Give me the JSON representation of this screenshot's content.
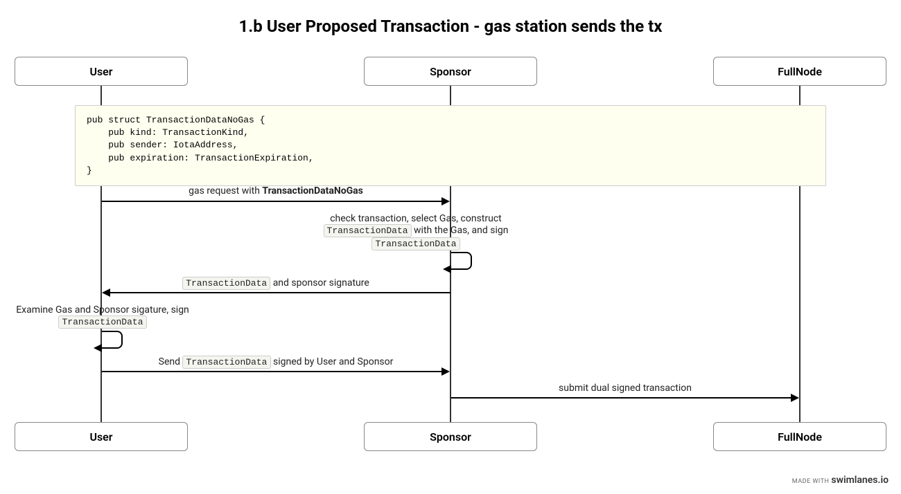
{
  "title": "1.b User Proposed Transaction - gas station sends the tx",
  "lanes": {
    "user": "User",
    "sponsor": "Sponsor",
    "fullnode": "FullNode"
  },
  "note_code": "pub struct TransactionDataNoGas {\n    pub kind: TransactionKind,\n    pub sender: IotaAddress,\n    pub expiration: TransactionExpiration,\n}",
  "messages": {
    "m1_prefix": "gas request with ",
    "m1_code": "TransactionDataNoGas",
    "m2_line1": "check transaction, select Gas, construct",
    "m2_code1": "TransactionData",
    "m2_mid": " with the Gas, and sign",
    "m2_code2": "TransactionData",
    "m3_code": "TransactionData",
    "m3_suffix": " and sponsor signature",
    "m4_line1": "Examine Gas and Sponsor sigature, sign",
    "m4_code": "TransactionData",
    "m5_prefix": "Send ",
    "m5_code": "TransactionData",
    "m5_suffix": " signed by User and Sponsor",
    "m6": "submit dual signed transaction"
  },
  "watermark_made": "MADE WITH",
  "watermark_brand": "swimlanes.io"
}
